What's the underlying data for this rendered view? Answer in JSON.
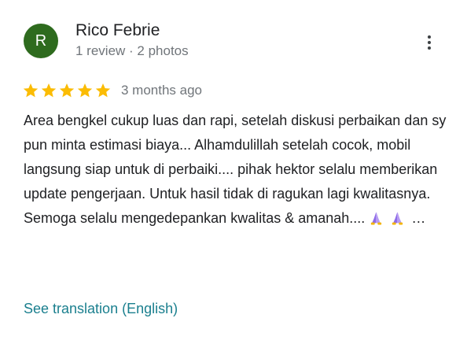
{
  "review": {
    "avatar_letter": "R",
    "avatar_color": "#2e6b1e",
    "reviewer_name": "Rico Febrie",
    "reviewer_meta": "1 review · 2 photos",
    "more_icon": "more-vert-icon",
    "rating": 5,
    "rating_max": 5,
    "star_color": "#fbbc04",
    "time_ago": "3 months ago",
    "text_main": "Area bengkel cukup luas dan rapi, setelah diskusi perbaikan dan sy pun minta estimasi biaya... Alhamdulillah setelah cocok, mobil langsung siap untuk di perbaiki.... pihak hektor selalu memberikan update pengerjaan. Untuk hasil tidak di ragukan lagi kwalitasnya. Semoga selalu mengedepankan kwalitas & amanah....",
    "emoji_icons": [
      "folded-hands-emoji",
      "folded-hands-emoji"
    ],
    "text_ellipsis": "…",
    "translate_link": "See translation (English)",
    "link_color": "#1a7f8e"
  }
}
